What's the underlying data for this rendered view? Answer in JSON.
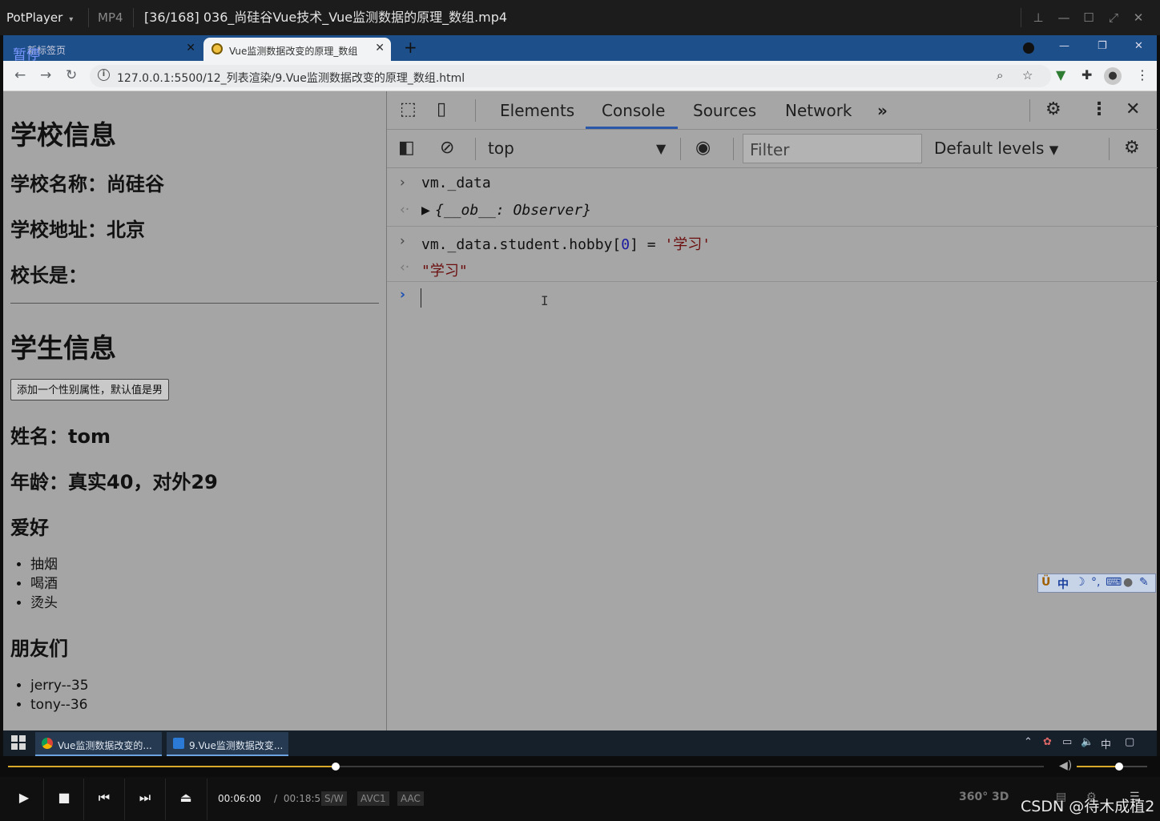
{
  "player": {
    "brand": "PotPlayer",
    "format": "MP4",
    "title": "[36/168] 036_尚硅谷Vue技术_Vue监测数据的原理_数组.mp4",
    "window_buttons": [
      "pin-icon",
      "minimize-icon",
      "maximize-icon",
      "fullscreen-icon",
      "close-icon"
    ]
  },
  "browser": {
    "tabs": [
      {
        "label": "新标签页",
        "overlay": "暂停",
        "active": false
      },
      {
        "label": "Vue监测数据改变的原理_数组",
        "active": true
      }
    ],
    "url": "127.0.0.1:5500/12_列表渲染/9.Vue监测数据改变的原理_数组.html"
  },
  "page": {
    "school_heading": "学校信息",
    "school_name": "学校名称：尚硅谷",
    "school_address": "学校地址：北京",
    "principal": "校长是：",
    "student_heading": "学生信息",
    "add_button": "添加一个性别属性，默认值是男",
    "name": "姓名：tom",
    "age": "年龄：真实40，对外29",
    "hobby_heading": "爱好",
    "hobbies": [
      "抽烟",
      "喝酒",
      "烫头"
    ],
    "friends_heading": "朋友们",
    "friends": [
      "jerry--35",
      "tony--36"
    ]
  },
  "devtools": {
    "tabs": [
      "Elements",
      "Console",
      "Sources",
      "Network"
    ],
    "active_tab": "Console",
    "more": "»",
    "context": "top",
    "filter_placeholder": "Filter",
    "levels": "Default levels",
    "console": [
      {
        "kind": "input",
        "text": "vm._data"
      },
      {
        "kind": "output",
        "text": "{__ob__: Observer}"
      },
      {
        "kind": "input",
        "code": "vm._data.student.hobby[",
        "index": "0",
        "assign": "] = ",
        "string": "'学习'"
      },
      {
        "kind": "output",
        "text": "\"学习\""
      }
    ],
    "ime": [
      "中",
      "☽",
      "°,",
      "⌨",
      "👤",
      "🔧"
    ]
  },
  "taskbar": {
    "items": [
      "Vue监测数据改变的...",
      "9.Vue监测数据改变..."
    ],
    "tray_lang": "中"
  },
  "playback": {
    "current": "00:06:00",
    "separator": "/",
    "total": "00:18:57",
    "progress": 0.3166,
    "volume": 0.6,
    "badges": [
      "S/W",
      "AVC1",
      "AAC"
    ],
    "right_icons": [
      "360°",
      "3D"
    ],
    "watermark": "CSDN @待木成植2"
  },
  "colors": {
    "accent": "#d9a92a",
    "tabstrip": "#1d4f8b",
    "console_link": "#2a57a8"
  }
}
